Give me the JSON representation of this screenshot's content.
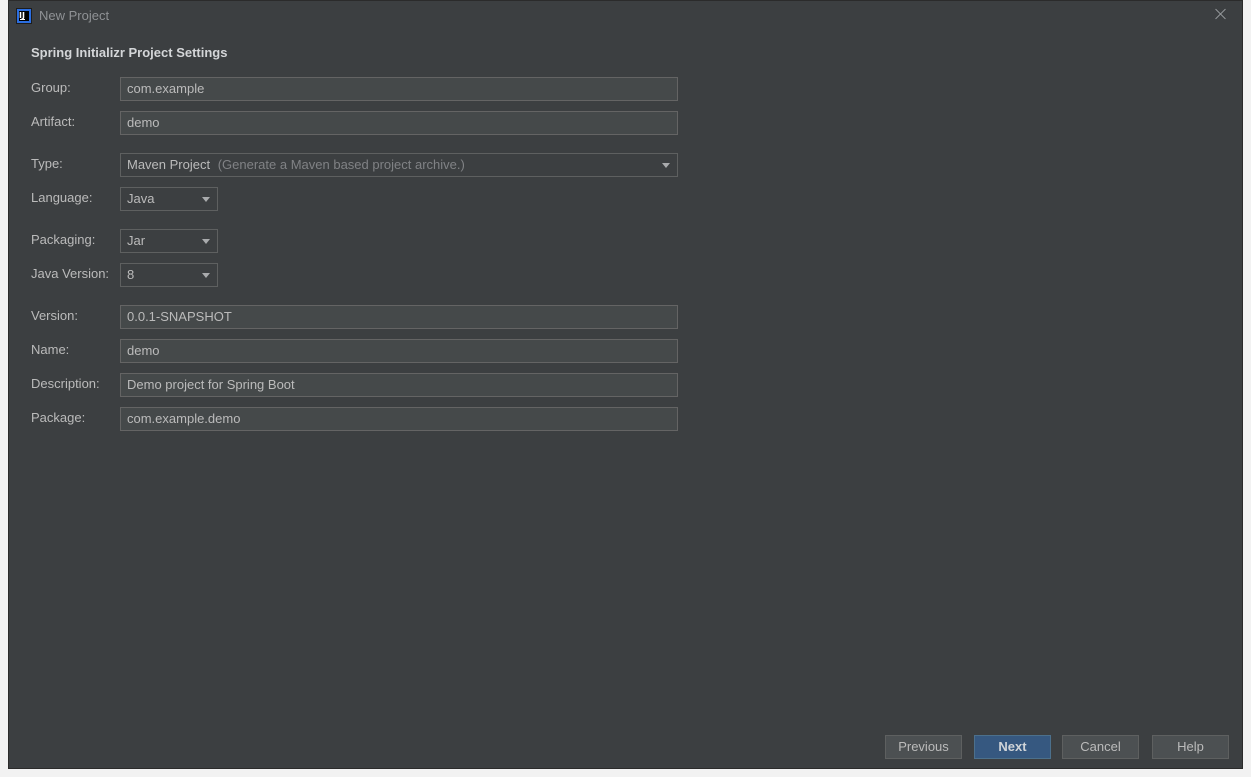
{
  "window": {
    "title": "New Project",
    "app_icon_text": "IJ"
  },
  "section_title": "Spring Initializr Project Settings",
  "fields": {
    "group": {
      "label": "Group:",
      "value": "com.example"
    },
    "artifact": {
      "label": "Artifact:",
      "value": "demo"
    },
    "type": {
      "label": "Type:",
      "value": "Maven Project",
      "hint": "(Generate a Maven based project archive.)"
    },
    "language": {
      "label": "Language:",
      "value": "Java"
    },
    "packaging": {
      "label": "Packaging:",
      "value": "Jar"
    },
    "java_version": {
      "label": "Java Version:",
      "value": "8"
    },
    "version": {
      "label": "Version:",
      "value": "0.0.1-SNAPSHOT"
    },
    "name": {
      "label": "Name:",
      "value": "demo"
    },
    "description": {
      "label": "Description:",
      "value": "Demo project for Spring Boot"
    },
    "package": {
      "label": "Package:",
      "value": "com.example.demo"
    }
  },
  "buttons": {
    "previous": "Previous",
    "next": "Next",
    "cancel": "Cancel",
    "help": "Help"
  },
  "colors": {
    "background": "#3c3f41",
    "primary_button": "#365880"
  }
}
